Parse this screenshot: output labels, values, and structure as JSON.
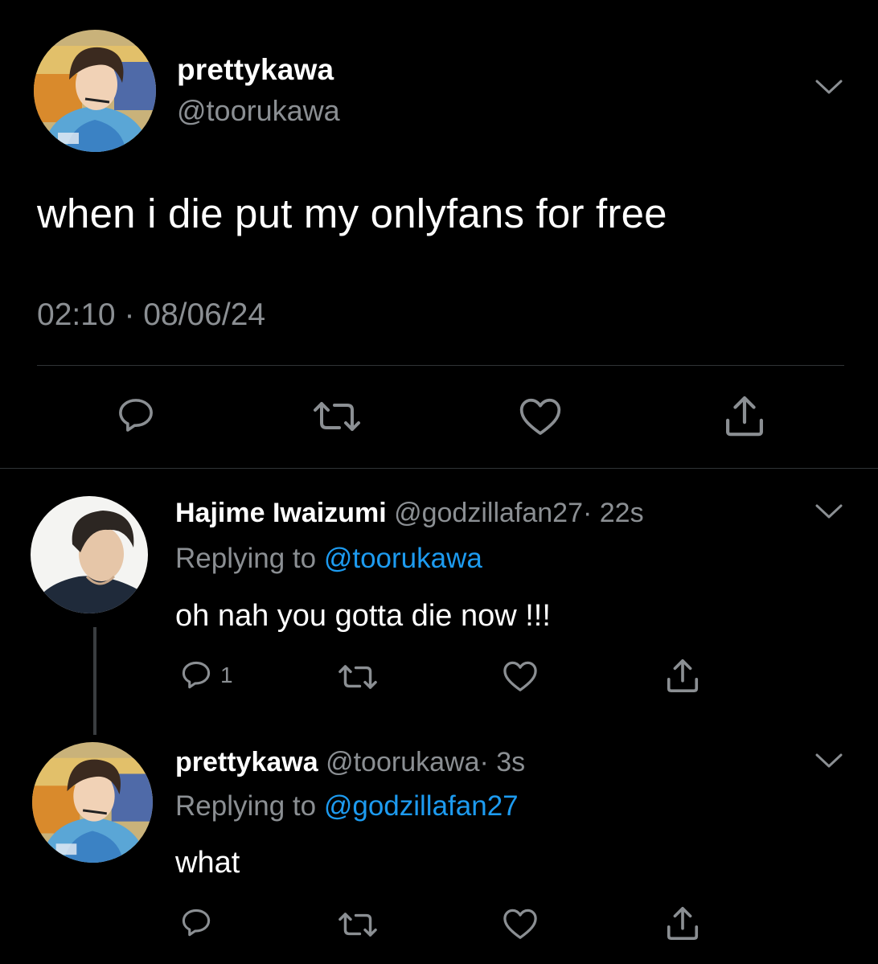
{
  "main_tweet": {
    "display_name": "prettykawa",
    "handle": "@toorukawa",
    "text": "when i die put my onlyfans for free",
    "time": "02:10",
    "separator": " · ",
    "date": "08/06/24"
  },
  "replies": [
    {
      "display_name": "Hajime Iwaizumi",
      "handle": "@godzillafan27",
      "age": "· 22s",
      "replying_prefix": "Replying to ",
      "replying_to": "@toorukawa",
      "text": "oh nah you gotta die now !!!",
      "reply_count": "1"
    },
    {
      "display_name": "prettykawa",
      "handle": "@toorukawa",
      "age": "· 3s",
      "replying_prefix": "Replying to ",
      "replying_to": "@godzillafan27",
      "text": "what",
      "reply_count": ""
    }
  ],
  "icons": {
    "reply": "speech-bubble-icon",
    "retweet": "retweet-arrows-icon",
    "like": "heart-icon",
    "share": "share-upload-icon",
    "menu": "chevron-down-icon"
  },
  "colors": {
    "background": "#000000",
    "secondary_text": "#8b8f93",
    "link": "#1d9bf0",
    "divider": "#2f3336"
  }
}
